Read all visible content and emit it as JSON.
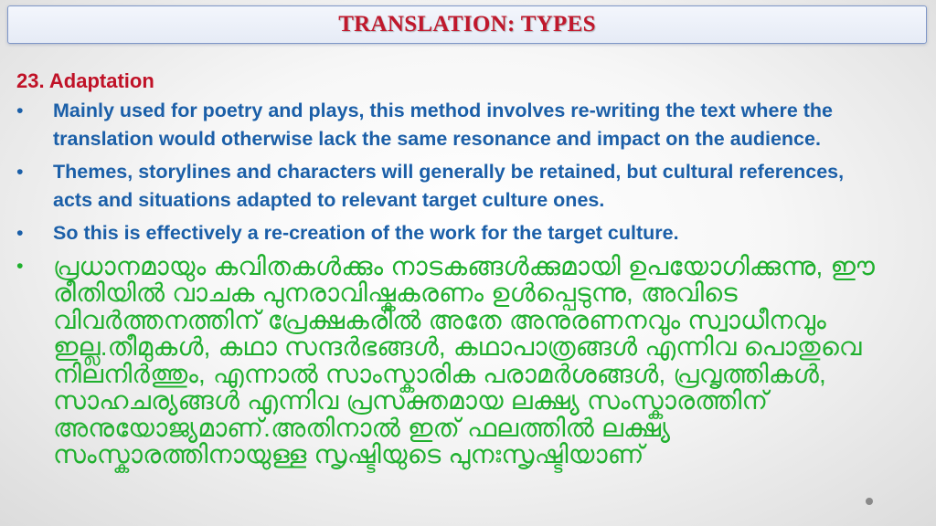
{
  "slide": {
    "title": "TRANSLATION: TYPES",
    "heading": "23. Adaptation",
    "bullet_char": "•",
    "bullets": [
      "Mainly used for poetry and plays, this method involves re-writing the text where the translation would otherwise lack the same resonance and impact on the audience.",
      "Themes, storylines and characters will generally be retained, but cultural references, acts and situations adapted to relevant target culture ones.",
      "So this is effectively a re-creation of the work for the target culture."
    ],
    "malayalam_bullet": "പ്രധാനമായും കവിതകൾക്കും നാടകങ്ങൾക്കുമായി ഉപയോഗിക്കുന്നു, ഈ രീതിയിൽ വാചക പുനരാവിഷ്കകരണം ഉൾപ്പെടുന്നു, അവിടെ വിവർത്തനത്തിന് പ്രേക്ഷകരിൽ അതേ അനുരണനവും സ്വാധീനവും ഇല്ല.തീമുകൾ, കഥാ സന്ദർഭങ്ങൾ, കഥാപാത്രങ്ങൾ എന്നിവ പൊതുവെ നിലനിർത്തും, എന്നാൽ സാംസ്കാരിക പരാമർശങ്ങൾ, പ്രവൃത്തികൾ, സാഹചര്യങ്ങൾ എന്നിവ പ്രസക്തമായ ലക്ഷ്യ സംസ്കാരത്തിന് അനുയോജ്യമാണ്.അതിനാൽ ഇത് ഫലത്തിൽ ലക്ഷ്യ സംസ്കാരത്തിനായുള്ള സൃഷ്ടിയുടെ പുനഃസൃഷ്ടിയാണ്"
  },
  "colors": {
    "title": "#c0182c",
    "heading": "#c01227",
    "english_text": "#1b5fa8",
    "malayalam_text": "#20b02e"
  }
}
